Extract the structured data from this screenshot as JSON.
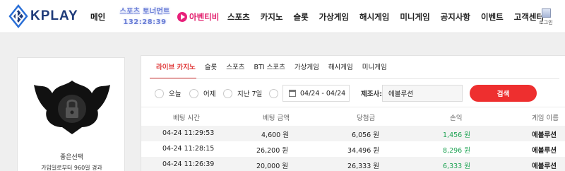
{
  "header": {
    "logo_text": "KPLAY",
    "nav": {
      "home": "메인",
      "sports_tournament": "스포츠 토너먼트",
      "tournament_timer": "132:28:39",
      "afreeca": "아벤티비",
      "items": [
        "스포츠",
        "카지노",
        "슬롯",
        "가상게임",
        "해시게임",
        "미니게임",
        "공지사항",
        "이벤트",
        "고객센터"
      ],
      "login_label": "로그인"
    }
  },
  "profile": {
    "name": "좋은선택",
    "since": "가입일로부터 960일 경과"
  },
  "tabs": [
    "라이브 카지노",
    "슬롯",
    "스포츠",
    "BTI 스포츠",
    "가상게임",
    "해시게임",
    "미니게임"
  ],
  "filter": {
    "options": [
      "오늘",
      "어제",
      "지난 7일"
    ],
    "date_range": "04/24 - 04/24",
    "search_label": "제조사:",
    "search_value": "에볼루션",
    "search_button": "검색"
  },
  "table": {
    "headers": [
      "베팅 시간",
      "베팅 금액",
      "당첨금",
      "손익",
      "게임 이름"
    ],
    "rows": [
      [
        "04-24 11:29:53",
        "4,600 원",
        "6,056 원",
        "1,456 원",
        "에볼루션"
      ],
      [
        "04-24 11:28:15",
        "26,200 원",
        "34,496 원",
        "8,296 원",
        "에볼루션"
      ],
      [
        "04-24 11:26:39",
        "20,000 원",
        "26,333 원",
        "6,333 원",
        "에볼루션"
      ]
    ]
  },
  "colors": {
    "accent": "#ee2f2f",
    "profit": "#1ea353",
    "brand": "#1f3b7a"
  }
}
